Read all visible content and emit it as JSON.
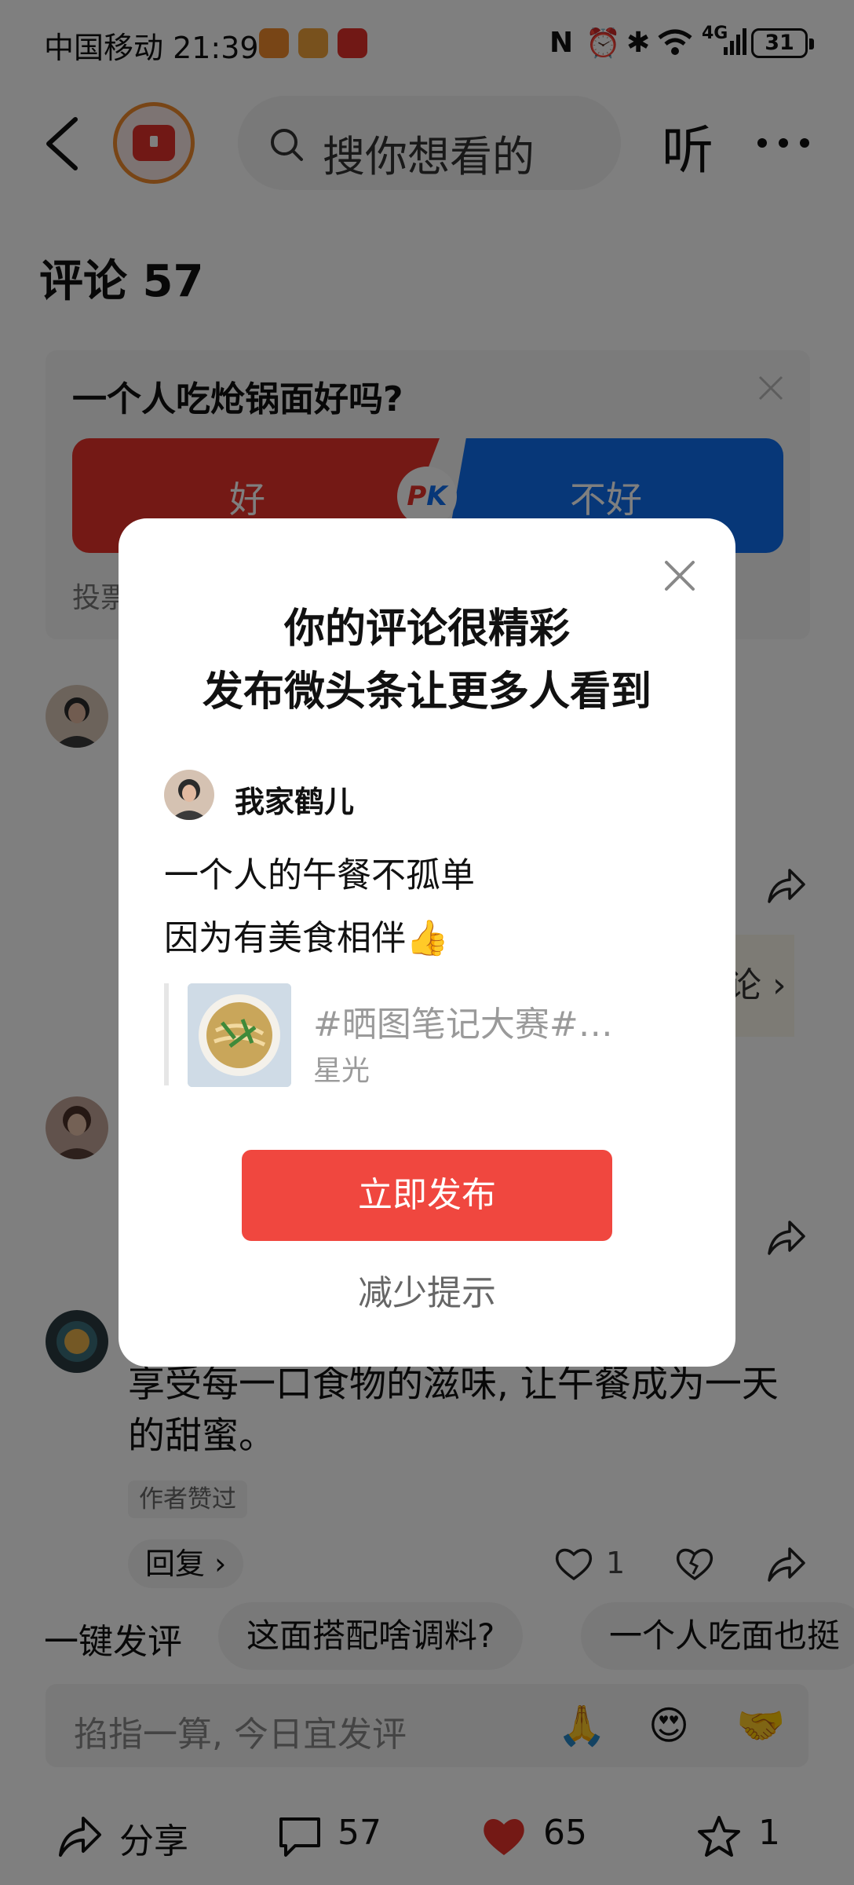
{
  "status_bar": {
    "carrier_time": "中国移动 21:39",
    "network": "4G",
    "battery": "31"
  },
  "navbar": {
    "search_placeholder": "搜你想看的",
    "listen_label": "听"
  },
  "comments": {
    "title": "评论 57"
  },
  "pk": {
    "question": "一个人吃炝锅面好吗?",
    "option_left": "好",
    "option_right": "不好",
    "badge": "PK",
    "votes_label": "投票"
  },
  "side_promo": {
    "text": "论 ›"
  },
  "comment3": {
    "text": "享受每一口食物的滋味, 让午餐成为一天的甜蜜。",
    "author_liked": "作者赞过",
    "reply_label": "回复 ›",
    "like_count": "1"
  },
  "quick_reply": {
    "label": "一键发评",
    "chips": [
      "这面搭配啥调料?",
      "一个人吃面也挺"
    ]
  },
  "input_bar": {
    "placeholder": "掐指一算, 今日宜发评",
    "emojis": [
      "🙏",
      "😍",
      "🤝"
    ]
  },
  "bottom_bar": {
    "share_label": "分享",
    "comment_count": "57",
    "like_count": "65",
    "favorite_count": "1"
  },
  "modal": {
    "title_line1": "你的评论很精彩",
    "title_line2": "发布微头条让更多人看到",
    "author": "我家鹤儿",
    "line1": "一个人的午餐不孤单",
    "line2": "因为有美食相伴👍",
    "quote_tag": "#晒图笔记大赛#…",
    "quote_sub": "星光",
    "publish_label": "立即发布",
    "less_tips_label": "减少提示"
  },
  "colors": {
    "accent_red": "#f0473f",
    "pk_red": "#e8322a",
    "pk_blue": "#0f6ff0"
  }
}
